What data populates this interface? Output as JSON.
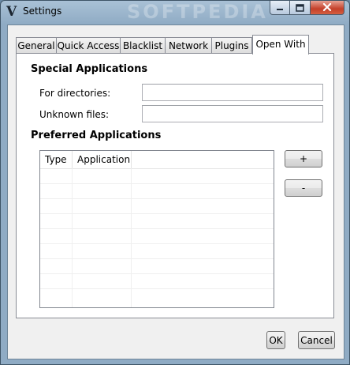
{
  "window": {
    "title": "Settings",
    "watermark": "SOFTPEDIA"
  },
  "caption_buttons": {
    "minimize_icon": "minimize-icon",
    "maximize_icon": "maximize-icon",
    "close_icon": "close-icon"
  },
  "tabs": [
    {
      "label": "General"
    },
    {
      "label": "Quick Access"
    },
    {
      "label": "Blacklist"
    },
    {
      "label": "Network"
    },
    {
      "label": "Plugins"
    },
    {
      "label": "Open With",
      "active": true
    }
  ],
  "special": {
    "heading": "Special Applications",
    "directories": {
      "label": "For directories:",
      "value": ""
    },
    "unknown": {
      "label": "Unknown files:",
      "value": ""
    }
  },
  "preferred": {
    "heading": "Preferred Applications",
    "columns": [
      "Type",
      "Application"
    ],
    "rows": [],
    "add_label": "+",
    "remove_label": "-"
  },
  "footer": {
    "ok_label": "OK",
    "cancel_label": "Cancel"
  }
}
